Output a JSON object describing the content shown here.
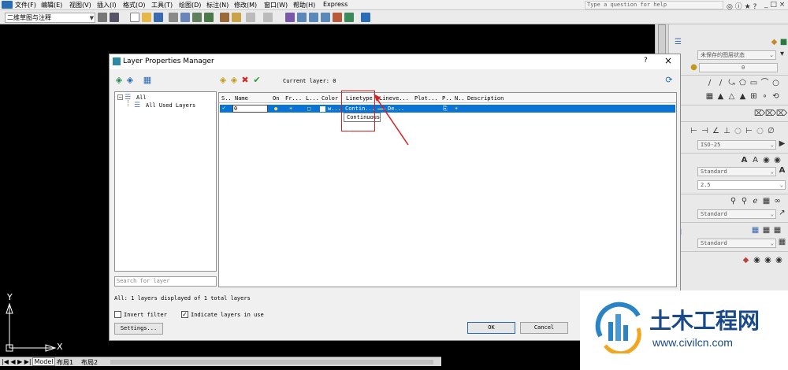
{
  "menu": {
    "items": [
      "文件(F)",
      "编辑(E)",
      "视图(V)",
      "插入(I)",
      "格式(O)",
      "工具(T)",
      "绘图(D)",
      "标注(N)",
      "修改(M)",
      "窗口(W)",
      "帮助(H)",
      "Express"
    ],
    "help_placeholder": "Type a question for help"
  },
  "toolbar": {
    "workspace": "二维草图与注释"
  },
  "right_panel": {
    "layer_state": "未保存的图层状态",
    "layer_current": "0",
    "dimstyle": "ISO-25",
    "textstyle": "Standard",
    "text_height": "2.5",
    "mleaderstyle": "Standard",
    "tablestyle": "Standard"
  },
  "dialog": {
    "title": "Layer Properties Manager",
    "help": "?",
    "close": "×",
    "current_layer_label": "Current layer: 0",
    "tree": {
      "root": "All",
      "child": "All Used Layers"
    },
    "search_placeholder": "Search for layer",
    "columns": [
      "S..",
      "Name",
      "On",
      "Fr...",
      "L...",
      "Color",
      "Linetype",
      "Lineve...",
      "Plot...",
      "P..",
      "N..",
      "Description"
    ],
    "row": {
      "name": "0",
      "color": "w...",
      "linetype": "Contin...",
      "lineweight": "De..."
    },
    "tooltip": "Continuous",
    "status": "All: 1 layers displayed of 1 total layers",
    "invert_filter": "Invert filter",
    "indicate_in_use": "Indicate layers in use",
    "settings": "Settings...",
    "ok": "OK",
    "cancel": "Cancel"
  },
  "canvas": {
    "y_axis": "Y",
    "x_axis": "X"
  },
  "tabs": [
    "Model",
    "布局1",
    "布局2"
  ],
  "watermark": {
    "name": "土木工程网",
    "url": "www.civilcn.com"
  },
  "colors": {
    "selection": "#0a74d6",
    "annotation": "#d81e1e",
    "bg": "#000000"
  }
}
